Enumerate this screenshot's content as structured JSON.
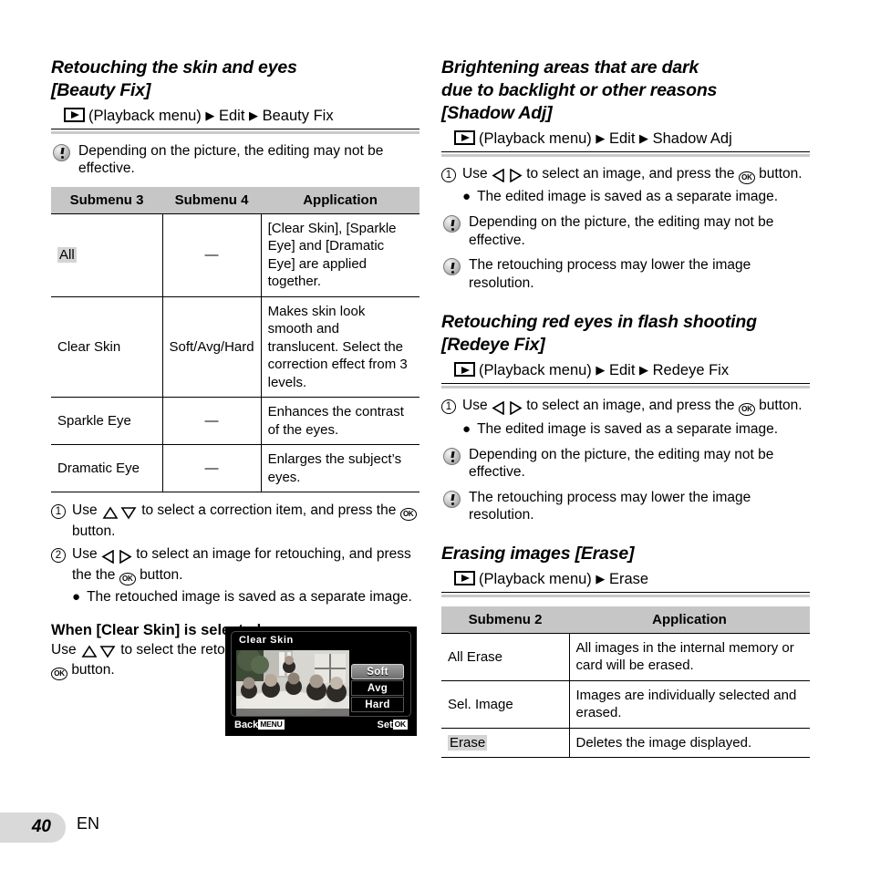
{
  "page": {
    "number": "40",
    "language": "EN"
  },
  "icons": {
    "playback": "playback-icon",
    "ok_button": "OK",
    "note": "caution-icon",
    "arrow_right_solid": "▶"
  },
  "left_column": {
    "section": {
      "title_line1": "Retouching the skin and eyes",
      "title_line2": "[Beauty Fix]",
      "path": {
        "menu_label": "(Playback menu)",
        "step1": "Edit",
        "step2": "Beauty Fix"
      }
    },
    "note": "Depending on the picture, the editing may not be effective.",
    "table": {
      "headers": [
        "Submenu 3",
        "Submenu 4",
        "Application"
      ],
      "rows": [
        {
          "submenu3": "All",
          "highlight": true,
          "submenu4": "—",
          "application": "[Clear Skin], [Sparkle Eye] and [Dramatic Eye] are applied together."
        },
        {
          "submenu3": "Clear Skin",
          "highlight": false,
          "submenu4": "Soft/Avg/Hard",
          "application": "Makes skin look smooth and translucent. Select the correction effect from 3 levels."
        },
        {
          "submenu3": "Sparkle Eye",
          "highlight": false,
          "submenu4": "—",
          "application": "Enhances the contrast of the eyes."
        },
        {
          "submenu3": "Dramatic Eye",
          "highlight": false,
          "submenu4": "—",
          "application": "Enlarges the subject’s eyes."
        }
      ]
    },
    "steps": [
      {
        "num": "1",
        "pre": "Use",
        "arrows": "updown",
        "mid": "to select a correction item, and press the",
        "post": "button."
      },
      {
        "num": "2",
        "pre": "Use",
        "arrows": "leftright",
        "mid": "to select an image for retouching, and press the",
        "post": "button."
      }
    ],
    "step_bullet": "The retouched image is saved as a separate image.",
    "clear_skin": {
      "heading": "When [Clear Skin] is selected",
      "pre": "Use",
      "arrows": "updown",
      "mid": "to select the retouching level, and press the",
      "post": "button."
    },
    "lcd": {
      "title": "Clear Skin",
      "options": [
        {
          "label": "Soft",
          "selected": true
        },
        {
          "label": "Avg",
          "selected": false
        },
        {
          "label": "Hard",
          "selected": false
        }
      ],
      "back_label": "Back",
      "back_badge": "MENU",
      "set_label": "Set",
      "set_badge": "OK"
    }
  },
  "right_column": {
    "shadow_adj": {
      "title_line1": "Brightening areas that are dark",
      "title_line2": "due to backlight or other reasons",
      "title_line3": "[Shadow Adj]",
      "path": {
        "menu_label": "(Playback menu)",
        "step1": "Edit",
        "step2": "Shadow Adj"
      },
      "step": {
        "num": "1",
        "pre": "Use",
        "arrows": "leftright",
        "mid": "to select an image, and press the",
        "post": "button."
      },
      "bullet": "The edited image is saved as a separate image.",
      "notes": [
        "Depending on the picture, the editing may not be effective.",
        "The retouching process may lower the image resolution."
      ]
    },
    "redeye_fix": {
      "title_line1": "Retouching red eyes in flash shooting",
      "title_line2": "[Redeye Fix]",
      "path": {
        "menu_label": "(Playback menu)",
        "step1": "Edit",
        "step2": "Redeye Fix"
      },
      "step": {
        "num": "1",
        "pre": "Use",
        "arrows": "leftright",
        "mid": "to select an image, and press the",
        "post": "button."
      },
      "bullet": "The edited image is saved as a separate image.",
      "notes": [
        "Depending on the picture, the editing may not be effective.",
        "The retouching process may lower the image resolution."
      ]
    },
    "erase": {
      "title": "Erasing images [Erase]",
      "path": {
        "menu_label": "(Playback menu)",
        "step1": "Erase"
      },
      "table": {
        "headers": [
          "Submenu 2",
          "Application"
        ],
        "rows": [
          {
            "submenu2": "All Erase",
            "highlight": false,
            "application": "All images in the internal memory or card will be erased."
          },
          {
            "submenu2": "Sel. Image",
            "highlight": false,
            "application": "Images are individually selected and erased."
          },
          {
            "submenu2": "Erase",
            "highlight": true,
            "application": "Deletes the image displayed."
          }
        ]
      }
    }
  }
}
